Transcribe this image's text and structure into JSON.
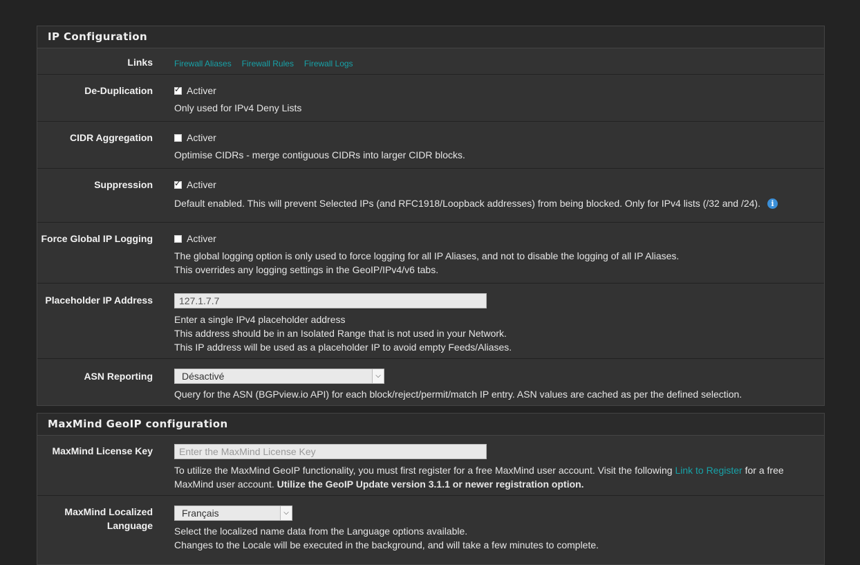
{
  "ip_config": {
    "title": "IP Configuration",
    "links": {
      "label": "Links",
      "items": [
        "Firewall Aliases",
        "Firewall Rules",
        "Firewall Logs"
      ]
    },
    "dedup": {
      "label": "De-Duplication",
      "checkbox": "Activer",
      "checked": true,
      "help": "Only used for IPv4 Deny Lists"
    },
    "cidr": {
      "label": "CIDR Aggregation",
      "checkbox": "Activer",
      "checked": false,
      "help": "Optimise CIDRs - merge contiguous CIDRs into larger CIDR blocks."
    },
    "suppression": {
      "label": "Suppression",
      "checkbox": "Activer",
      "checked": true,
      "help": "Default enabled. This will prevent Selected IPs (and RFC1918/Loopback addresses) from being blocked. Only for IPv4 lists (/32 and /24)."
    },
    "force_logging": {
      "label": "Force Global IP Logging",
      "checkbox": "Activer",
      "checked": false,
      "help1": "The global logging option is only used to force logging for all IP Aliases, and not to disable the logging of all IP Aliases.",
      "help2": "This overrides any logging settings in the GeoIP/IPv4/v6 tabs."
    },
    "placeholder": {
      "label": "Placeholder IP Address",
      "value": "127.1.7.7",
      "help1": "Enter a single IPv4 placeholder address",
      "help2": "This address should be in an Isolated Range that is not used in your Network.",
      "help3": "This IP address will be used as a placeholder IP to avoid empty Feeds/Aliases."
    },
    "asn": {
      "label": "ASN Reporting",
      "selected": "Désactivé",
      "help": "Query for the ASN (BGPview.io API) for each block/reject/permit/match IP entry. ASN values are cached as per the defined selection."
    }
  },
  "maxmind": {
    "title": "MaxMind GeoIP configuration",
    "license": {
      "label": "MaxMind License Key",
      "placeholder": "Enter the MaxMind License Key",
      "help_pre": "To utilize the MaxMind GeoIP functionality, you must first register for a free MaxMind user account. Visit the following ",
      "link": "Link to Register",
      "help_post": " for a free MaxMind user account. ",
      "help_bold": "Utilize the GeoIP Update version 3.1.1 or newer registration option."
    },
    "language": {
      "label_line1": "MaxMind Localized",
      "label_line2": "Language",
      "selected": "Français",
      "help1": "Select the localized name data from the Language options available.",
      "help2": "Changes to the Locale will be executed in the background, and will take a few minutes to complete."
    }
  }
}
